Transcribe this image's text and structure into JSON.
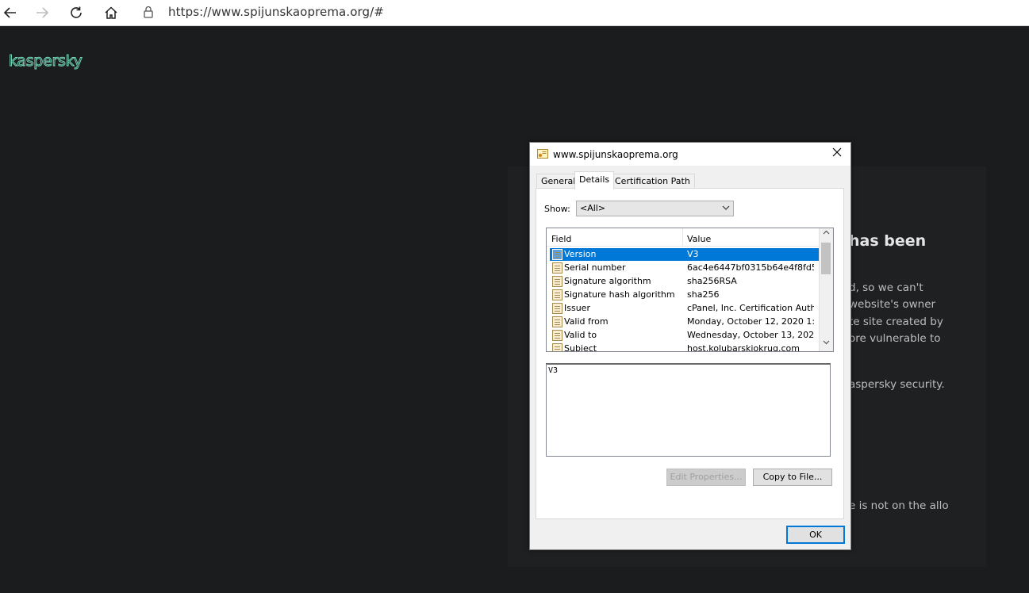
{
  "browser": {
    "url": "https://www.spijunskaoprema.org/#"
  },
  "page": {
    "logo": "kaspersky",
    "heading": "has been",
    "lines": [
      "d, so we can't",
      "website's owner",
      "te site created by",
      "ore vulnerable to",
      "aspersky security.",
      "e is not on the allo"
    ]
  },
  "dialog": {
    "title": "www.spijunskaoprema.org",
    "tabs": [
      "General",
      "Details",
      "Certification Path"
    ],
    "show_label": "Show:",
    "show_value": "<All>",
    "columns": [
      "Field",
      "Value"
    ],
    "rows": [
      {
        "field": "Version",
        "value": "V3"
      },
      {
        "field": "Serial number",
        "value": "6ac4e6447bf0315b64e4f8fd5f..."
      },
      {
        "field": "Signature algorithm",
        "value": "sha256RSA"
      },
      {
        "field": "Signature hash algorithm",
        "value": "sha256"
      },
      {
        "field": "Issuer",
        "value": "cPanel, Inc. Certification Auth..."
      },
      {
        "field": "Valid from",
        "value": "Monday, October 12, 2020 1:..."
      },
      {
        "field": "Valid to",
        "value": "Wednesday, October 13, 202..."
      },
      {
        "field": "Subject",
        "value": "host.kolubarskiokrug.com"
      }
    ],
    "detail_text": "V3",
    "edit_properties": "Edit Properties...",
    "copy_to_file": "Copy to File...",
    "ok": "OK"
  },
  "colors": {
    "accent": "#0078d7",
    "page_bg": "#1b1c1e",
    "logo_green": "#6fd3b5"
  }
}
